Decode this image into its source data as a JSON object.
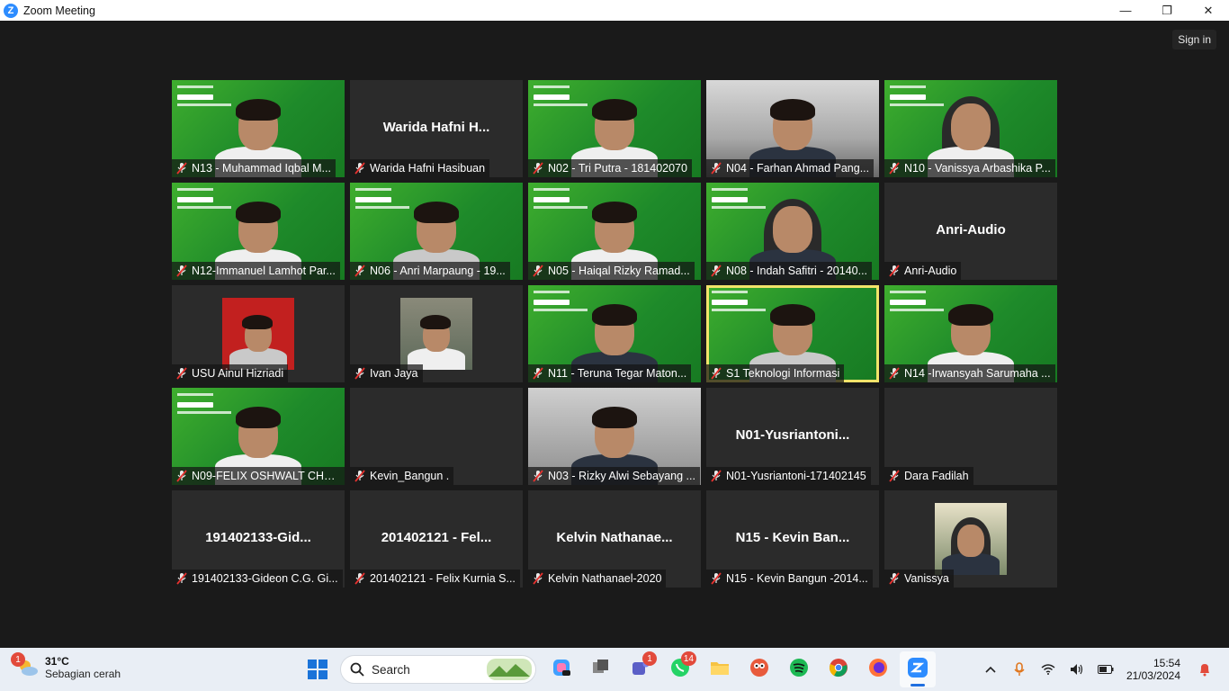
{
  "window": {
    "title": "Zoom Meeting",
    "app_icon_glyph": "Z",
    "minimize": "—",
    "maximize": "❐",
    "close": "✕"
  },
  "meeting": {
    "sign_in_label": "Sign in",
    "tiles": [
      {
        "kind": "video",
        "name": "N13 - Muhammad Iqbal M..."
      },
      {
        "kind": "audio",
        "big_name": "Warida  Hafni  H...",
        "name": "Warida Hafni Hasibuan"
      },
      {
        "kind": "video",
        "name": "N02 - Tri Putra - 181402070"
      },
      {
        "kind": "video",
        "name": "N04 - Farhan Ahmad Pang..."
      },
      {
        "kind": "video",
        "name": "N10 - Vanissya Arbashika P..."
      },
      {
        "kind": "video",
        "name": "N12-Immanuel Lamhot Par..."
      },
      {
        "kind": "video",
        "name": "N06 - Anri Marpaung - 19..."
      },
      {
        "kind": "video",
        "name": "N05 - Haiqal Rizky Ramad..."
      },
      {
        "kind": "video",
        "name": "N08 - Indah Safitri - 20140..."
      },
      {
        "kind": "audio",
        "big_name": "Anri-Audio",
        "name": "Anri-Audio"
      },
      {
        "kind": "photo",
        "name": "USU Ainul Hizriadi"
      },
      {
        "kind": "photo",
        "name": "Ivan Jaya"
      },
      {
        "kind": "video",
        "name": "N11 - Teruna Tegar Maton..."
      },
      {
        "kind": "video",
        "name": "S1 Teknologi Informasi",
        "active": true
      },
      {
        "kind": "video",
        "name": "N14 -Irwansyah Sarumaha ..."
      },
      {
        "kind": "video",
        "name": "N09-FELIX OSHWALT CHRI..."
      },
      {
        "kind": "blank",
        "name": "Kevin_Bangun ."
      },
      {
        "kind": "video",
        "name": "N03 - Rizky Alwi Sebayang ..."
      },
      {
        "kind": "audio",
        "big_name": "N01-Yusriantoni...",
        "name": "N01-Yusriantoni-171402145"
      },
      {
        "kind": "blank",
        "name": "Dara Fadilah"
      },
      {
        "kind": "audio",
        "big_name": "191402133-Gid...",
        "name": "191402133-Gideon C.G. Gi..."
      },
      {
        "kind": "audio",
        "big_name": "201402121 - Fel...",
        "name": "201402121 - Felix Kurnia S..."
      },
      {
        "kind": "audio",
        "big_name": "Kelvin  Nathanae...",
        "name": "Kelvin Nathanael-2020"
      },
      {
        "kind": "audio",
        "big_name": "N15 - Kevin Ban...",
        "name": "N15 - Kevin Bangun -2014..."
      },
      {
        "kind": "photo",
        "name": "Vanissya"
      }
    ]
  },
  "taskbar": {
    "weather": {
      "temp": "31°C",
      "condition": "Sebagian cerah",
      "badge": "1"
    },
    "search_placeholder": "Search",
    "apps": [
      {
        "icon": "copilot-icon",
        "badge": ""
      },
      {
        "icon": "task-view-icon",
        "badge": ""
      },
      {
        "icon": "teams-icon",
        "badge": "1"
      },
      {
        "icon": "whatsapp-icon",
        "badge": "14"
      },
      {
        "icon": "file-explorer-icon",
        "badge": ""
      },
      {
        "icon": "photo-app-icon",
        "badge": ""
      },
      {
        "icon": "spotify-icon",
        "badge": ""
      },
      {
        "icon": "chrome-icon",
        "badge": ""
      },
      {
        "icon": "firefox-icon",
        "badge": ""
      },
      {
        "icon": "zoom-icon",
        "badge": ""
      }
    ],
    "clock": {
      "time": "15:54",
      "date": "21/03/2024"
    }
  }
}
